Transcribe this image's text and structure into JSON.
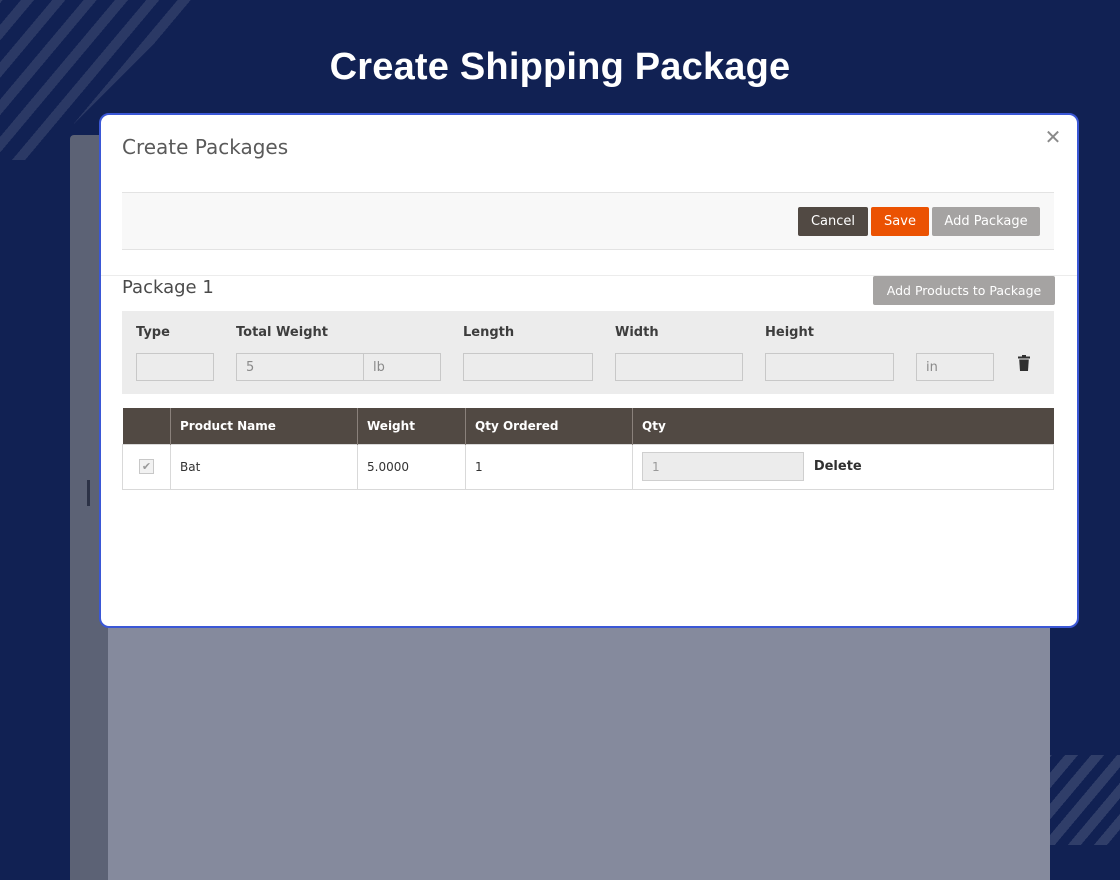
{
  "page": {
    "heading": "Create Shipping Package"
  },
  "modal": {
    "title": "Create Packages",
    "close_glyph": "✕",
    "toolbar": {
      "cancel_label": "Cancel",
      "save_label": "Save",
      "add_package_label": "Add Package"
    },
    "package": {
      "title": "Package 1",
      "add_products_label": "Add Products to Package",
      "fields": {
        "type_label": "Type",
        "type_value": "",
        "total_weight_label": "Total Weight",
        "total_weight_value": "5",
        "weight_unit": "lb",
        "length_label": "Length",
        "length_value": "",
        "width_label": "Width",
        "width_value": "",
        "height_label": "Height",
        "height_value": "",
        "dimension_unit": "in"
      },
      "table": {
        "headers": [
          "",
          "Product Name",
          "Weight",
          "Qty Ordered",
          "Qty"
        ],
        "rows": [
          {
            "checked": true,
            "product_name": "Bat",
            "weight": "5.0000",
            "qty_ordered": "1",
            "qty": "1",
            "delete_label": "Delete"
          }
        ]
      }
    }
  },
  "colors": {
    "page_background": "#112153",
    "modal_border": "#3a57d6",
    "cancel_button": "#514943",
    "save_button": "#eb5202",
    "secondary_button": "#a5a3a2",
    "table_header": "#514943"
  },
  "icons": {
    "close": "close-icon",
    "trash": "trash-icon",
    "checkbox": "checkmark-icon"
  }
}
